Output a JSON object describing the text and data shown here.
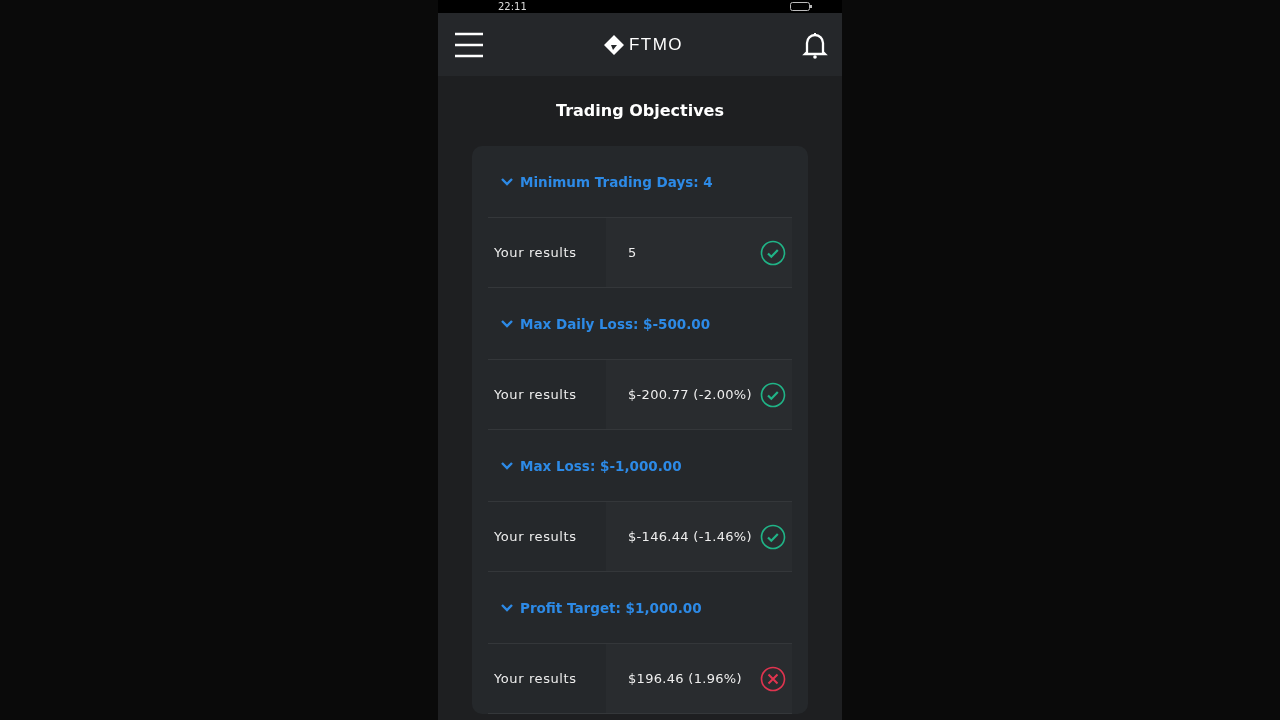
{
  "status_bar": {
    "time": "22:11"
  },
  "header": {
    "logo": "FTMO"
  },
  "title": "Trading Objectives",
  "objectives": [
    {
      "label": "Minimum Trading Days: 4",
      "expanded": true,
      "result_label": "Your results",
      "result": "5",
      "passed": true
    },
    {
      "label": "Max Daily Loss: $-500.00",
      "expanded": true,
      "result_label": "Your results",
      "result": "$-200.77 (-2.00%)",
      "passed": true
    },
    {
      "label": "Max Loss: $-1,000.00",
      "expanded": true,
      "result_label": "Your results",
      "result": "$-146.44 (-1.46%)",
      "passed": true
    },
    {
      "label": "Profit Target: $1,000.00",
      "expanded": true,
      "result_label": "Your results",
      "result": "$196.46 (1.96%)",
      "passed": false
    }
  ]
}
